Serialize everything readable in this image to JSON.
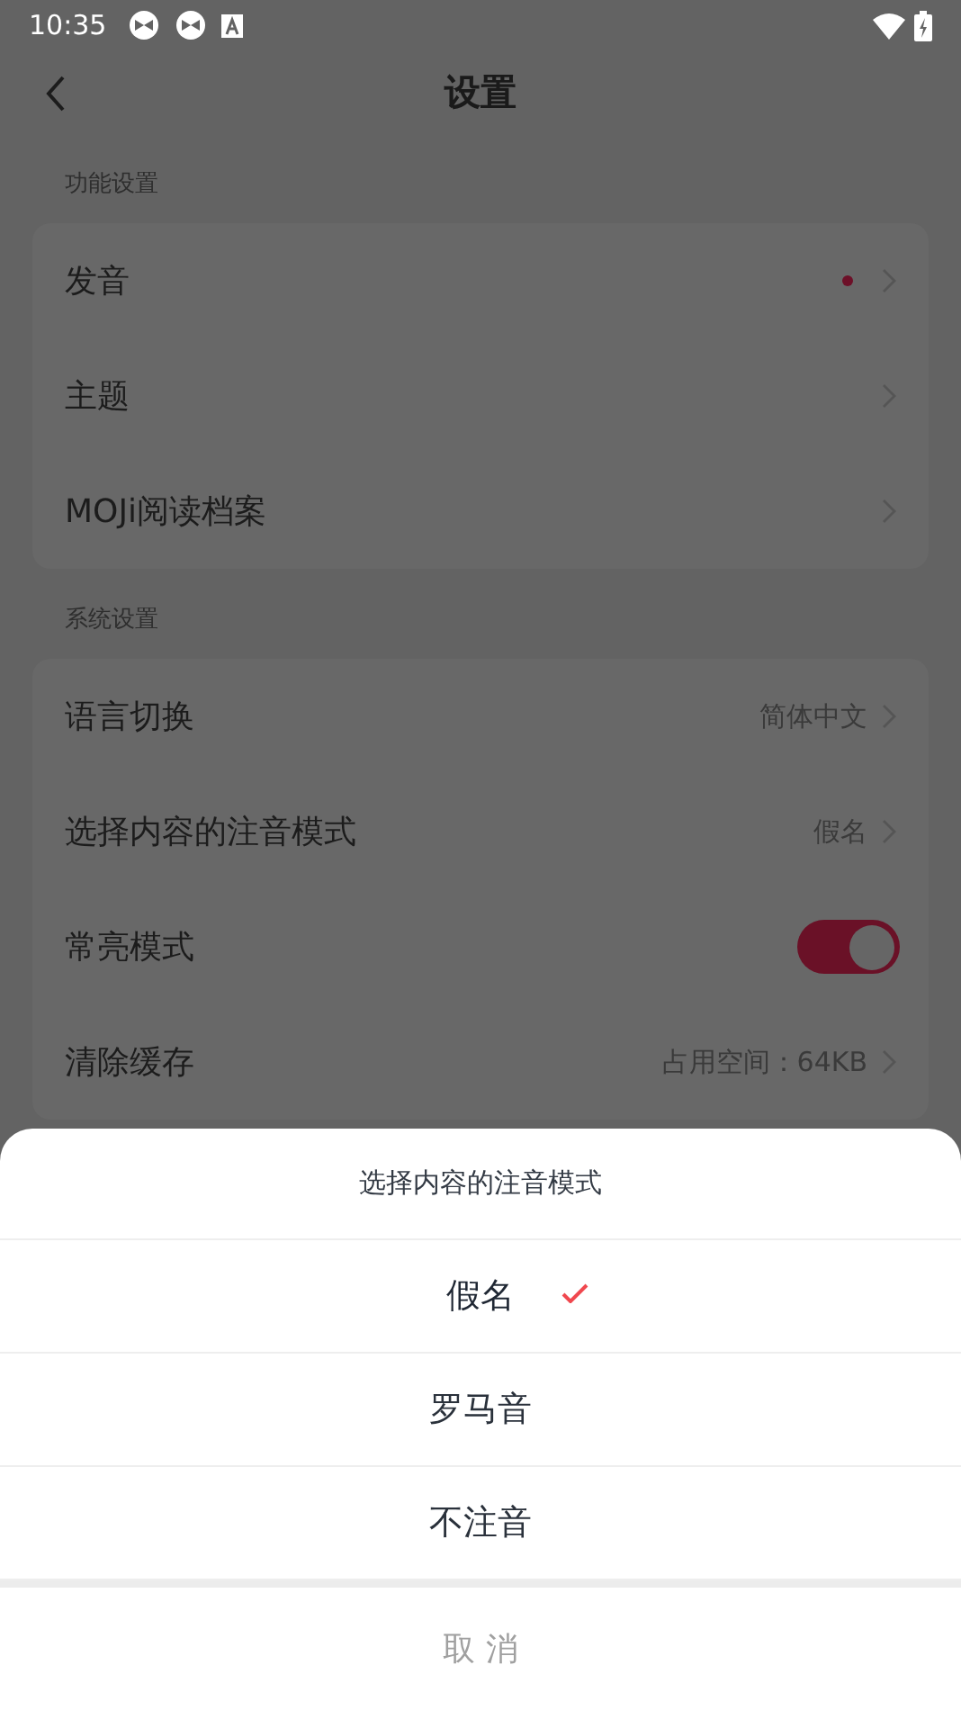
{
  "status_bar": {
    "time": "10:35"
  },
  "header": {
    "title": "设置"
  },
  "sections": [
    {
      "title": "功能设置",
      "items": [
        {
          "kind": "link",
          "label": "发音",
          "dot": true
        },
        {
          "kind": "link",
          "label": "主题"
        },
        {
          "kind": "link",
          "label": "MOJi阅读档案"
        }
      ]
    },
    {
      "title": "系统设置",
      "items": [
        {
          "kind": "link",
          "label": "语言切换",
          "value": "简体中文"
        },
        {
          "kind": "link",
          "label": "选择内容的注音模式",
          "value": "假名"
        },
        {
          "kind": "toggle",
          "label": "常亮模式",
          "on": true
        },
        {
          "kind": "link",
          "label": "清除缓存",
          "value": "占用空间：64KB"
        }
      ]
    }
  ],
  "sheet": {
    "title": "选择内容的注音模式",
    "options": [
      {
        "label": "假名",
        "selected": true
      },
      {
        "label": "罗马音",
        "selected": false
      },
      {
        "label": "不注音",
        "selected": false
      }
    ],
    "cancel": "取 消"
  }
}
